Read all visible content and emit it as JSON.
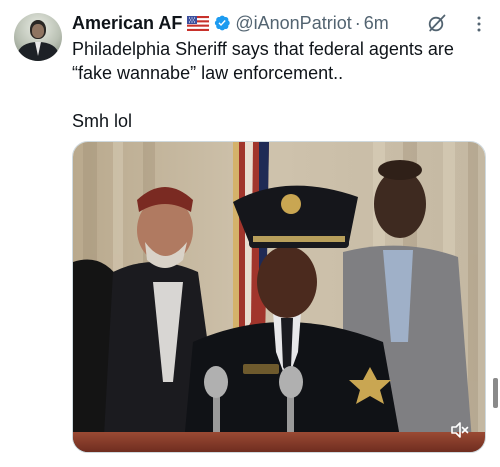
{
  "tweet": {
    "author_name": "American AF",
    "flag": "🇺🇸",
    "handle": "@iAnonPatriot",
    "separator": "·",
    "time": "6m",
    "text_line1": "Philadelphia Sheriff says that federal agents are",
    "text_line2": "“fake wannabe” law enforcement..",
    "text_line3": "Smh lol",
    "icons": {
      "verified": "verified-badge-icon",
      "grok": "grok-icon",
      "more": "more-options-icon",
      "mute": "muted-speaker-icon"
    },
    "colors": {
      "verified_blue": "#1d9bf0",
      "secondary_text": "#536471",
      "primary_text": "#0f1419"
    }
  }
}
